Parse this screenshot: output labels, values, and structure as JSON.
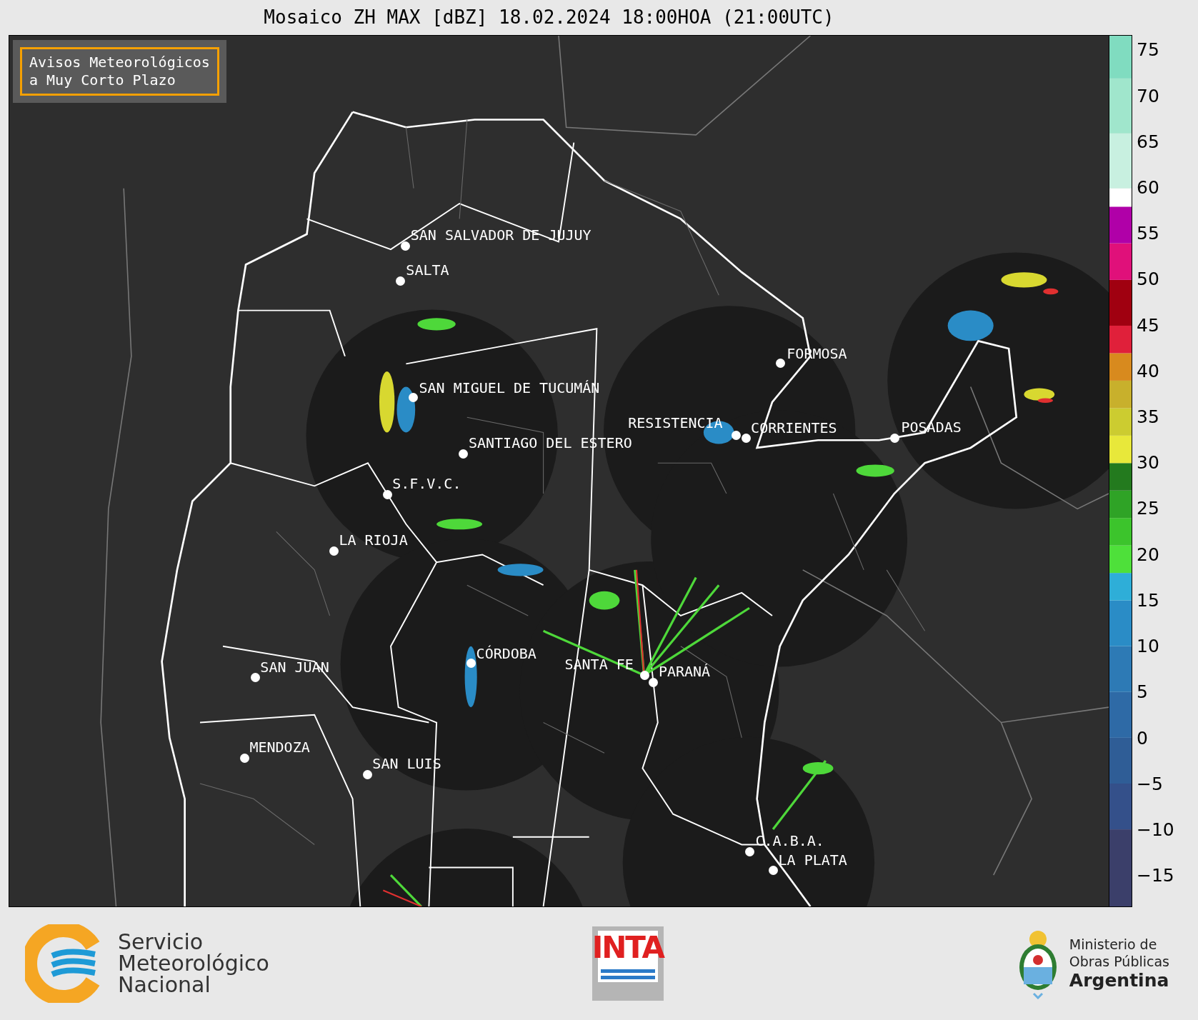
{
  "title": "Mosaico ZH MAX [dBZ] 18.02.2024 18:00HOA (21:00UTC)",
  "legend_box": {
    "lines": [
      "Avisos Meteorológicos",
      "a Muy Corto Plazo"
    ]
  },
  "cities": [
    {
      "name": "SAN SALVADOR DE JUJUY"
    },
    {
      "name": "SALTA"
    },
    {
      "name": "FORMOSA"
    },
    {
      "name": "SAN MIGUEL DE TUCUMÁN"
    },
    {
      "name": "RESISTENCIA"
    },
    {
      "name": "CORRIENTES"
    },
    {
      "name": "POSADAS"
    },
    {
      "name": "SANTIAGO DEL ESTERO"
    },
    {
      "name": "S.F.V.C."
    },
    {
      "name": "LA RIOJA"
    },
    {
      "name": "SAN JUAN"
    },
    {
      "name": "CÓRDOBA"
    },
    {
      "name": "SANTA FE"
    },
    {
      "name": "PARANÁ"
    },
    {
      "name": "MENDOZA"
    },
    {
      "name": "SAN LUIS"
    },
    {
      "name": "C.A.B.A."
    },
    {
      "name": "LA PLATA"
    }
  ],
  "colorbar": {
    "ticks": [
      "75",
      "70",
      "65",
      "60",
      "55",
      "50",
      "45",
      "40",
      "35",
      "30",
      "25",
      "20",
      "15",
      "10",
      "5",
      "0",
      "−5",
      "−10",
      "−15"
    ]
  },
  "footer": {
    "smn_lines": [
      "Servicio",
      "Meteorológico",
      "Nacional"
    ],
    "inta": "INTA",
    "ministry_lines": [
      "Ministerio de",
      "Obras Públicas",
      "Argentina"
    ]
  }
}
